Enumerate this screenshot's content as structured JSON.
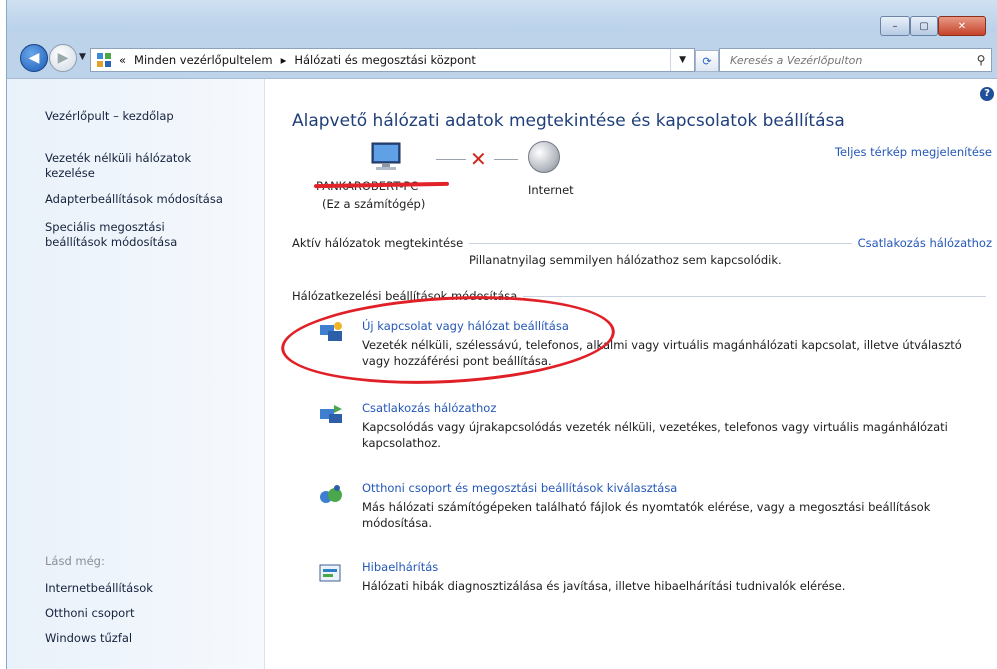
{
  "window": {
    "min": "–",
    "max": "▢",
    "close": "✕"
  },
  "nav": {
    "breadcrumb": [
      "«",
      "Minden vezérlőpultelem",
      "Hálózati és megosztási központ"
    ],
    "sep": "▸",
    "search_placeholder": "Keresés a Vezérlőpulton"
  },
  "sidebar": {
    "items": [
      "Vezérlőpult – kezdőlap",
      "Vezeték nélküli hálózatok kezelése",
      "Adapterbeállítások módosítása",
      "Speciális megosztási beállítások módosítása"
    ],
    "see_also_header": "Lásd még:",
    "see_also": [
      "Internetbeállítások",
      "Otthoni csoport",
      "Windows tűzfal"
    ]
  },
  "main": {
    "title": "Alapvető hálózati adatok megtekintése és kapcsolatok beállítása",
    "full_map_link": "Teljes térkép megjelenítése",
    "computer_name": "PANKAROBERT-PC",
    "computer_sub": "(Ez a számítógép)",
    "internet_label": "Internet",
    "active_networks_header": "Aktív hálózatok megtekintése",
    "connect_link": "Csatlakozás hálózathoz",
    "no_network_text": "Pillanatnyilag semmilyen hálózathoz sem kapcsolódik.",
    "settings_header": "Hálózatkezelési beállítások módosítása",
    "tasks": [
      {
        "link": "Új kapcsolat vagy hálózat beállítása",
        "desc": "Vezeték nélküli, szélessávú, telefonos, alkalmi vagy virtuális magánhálózati kapcsolat, illetve útválasztó vagy hozzáférési pont beállítása.",
        "icon": "network-setup-icon"
      },
      {
        "link": "Csatlakozás hálózathoz",
        "desc": "Kapcsolódás vagy újrakapcsolódás vezeték nélküli, vezetékes, telefonos vagy virtuális magánhálózati kapcsolathoz.",
        "icon": "connect-network-icon"
      },
      {
        "link": "Otthoni csoport és megosztási beállítások kiválasztása",
        "desc": "Más hálózati számítógépeken található fájlok és nyomtatók elérése, vagy a megosztási beállítások módosítása.",
        "icon": "homegroup-icon"
      },
      {
        "link": "Hibaelhárítás",
        "desc": "Hálózati hibák diagnosztizálása és javítása, illetve hibaelhárítási tudnivalók elérése.",
        "icon": "troubleshoot-icon"
      }
    ]
  },
  "colors": {
    "link": "#2457b8",
    "title": "#1f3f7a",
    "annotation_red": "#e01f26"
  }
}
